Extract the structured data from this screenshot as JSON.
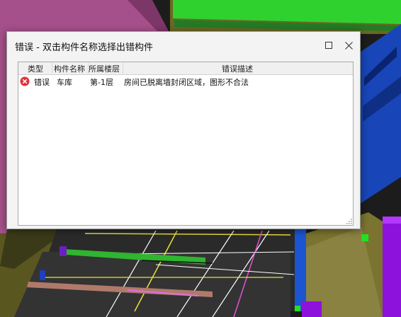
{
  "window": {
    "title": "错误 - 双击构件名称选择出错构件",
    "maximize_icon": "maximize-icon",
    "close_icon": "close-icon"
  },
  "table": {
    "columns": [
      "类型",
      "构件名称",
      "所属楼层",
      "错误描述"
    ],
    "rows": [
      {
        "icon": "error-icon",
        "type": "错误",
        "component": "车库",
        "floor": "第-1层",
        "description": "房间已脱离墙封闭区域，图形不合法"
      }
    ]
  },
  "colors": {
    "error_red": "#e0313a",
    "magenta_wall": "#a84f87",
    "green_accent": "#2ecf2e",
    "blue_wall": "#1846b8",
    "olive_floor": "#6e6a26",
    "purple_column": "#8a0fd8"
  }
}
